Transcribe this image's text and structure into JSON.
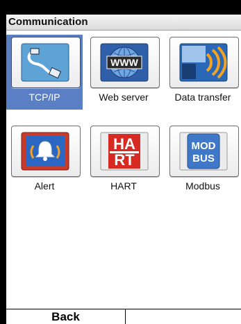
{
  "title": "Communication",
  "tiles": [
    {
      "label": "TCP/IP",
      "icon": "network-cable-icon",
      "selected": true
    },
    {
      "label": "Web server",
      "icon": "www-globe-icon",
      "selected": false
    },
    {
      "label": "Data transfer",
      "icon": "data-transfer-icon",
      "selected": false
    },
    {
      "label": "Alert",
      "icon": "alert-bell-icon",
      "selected": false
    },
    {
      "label": "HART",
      "icon": "hart-icon",
      "selected": false
    },
    {
      "label": "Modbus",
      "icon": "modbus-icon",
      "selected": false
    }
  ],
  "icon_text": {
    "www": "WWW",
    "hart_top": "HA",
    "hart_bottom": "RT",
    "modbus_top": "MOD",
    "modbus_bottom": "BUS"
  },
  "softkeys": {
    "left": "Back",
    "right": ""
  },
  "colors": {
    "selection": "#5a7fc4",
    "tcp_bg": "#5ea3d6",
    "web_bg": "#2f5fa8",
    "transfer_bg": "#2a67b6",
    "alert_border": "#c83a2a",
    "hart_red": "#d62a22",
    "modbus_bg": "#3f78c8"
  }
}
